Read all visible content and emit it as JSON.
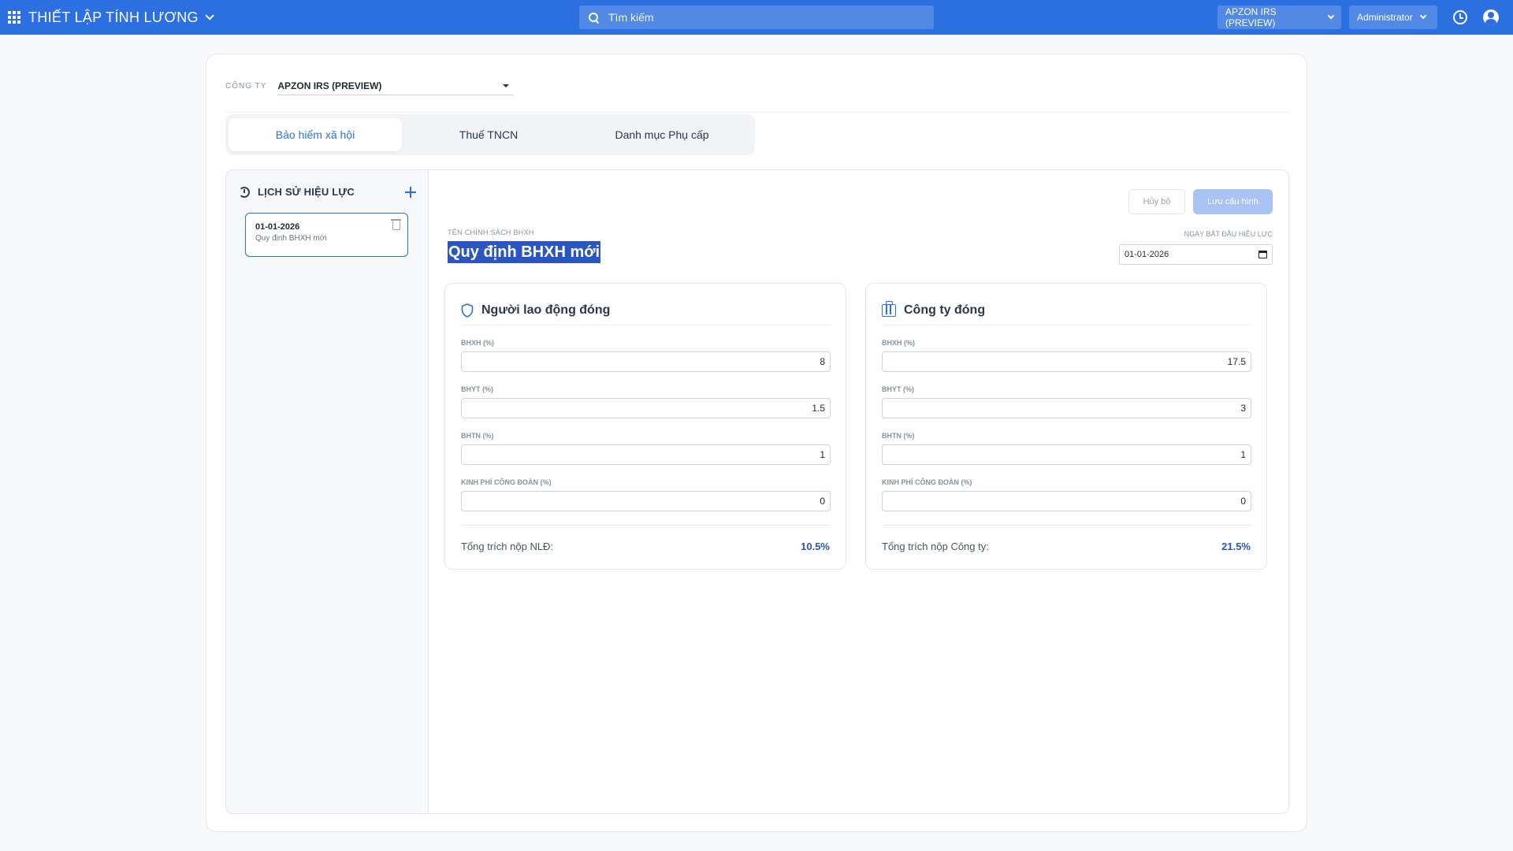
{
  "header": {
    "app_title": "THIẾT LẬP TÍNH LƯƠNG",
    "search_placeholder": "Tìm kiếm",
    "company_dropdown": "APZON IRS (PREVIEW)",
    "user_dropdown": "Administrator",
    "icons": [
      "apps-grid-icon",
      "search-icon",
      "clock-icon",
      "user-icon"
    ]
  },
  "company": {
    "label": "CÔNG TY",
    "selected": "APZON IRS (PREVIEW)"
  },
  "tabs": [
    {
      "label": "Bảo hiểm xã hội",
      "active": true
    },
    {
      "label": "Thuế TNCN",
      "active": false
    },
    {
      "label": "Danh mục Phụ cấp",
      "active": false
    }
  ],
  "history": {
    "title": "LỊCH SỬ HIỆU LỰC",
    "items": [
      {
        "date": "01-01-2026",
        "name": "Quy định BHXH mới"
      }
    ]
  },
  "form": {
    "cancel_label": "Hủy bỏ",
    "save_label": "Lưu cấu hình",
    "policy_label": "TÊN CHÍNH SÁCH BHXH",
    "policy_name": "Quy định BHXH mới",
    "date_label": "NGÀY BẮT ĐẦU HIỆU LỰC",
    "date_value": "01-01-2026"
  },
  "employee": {
    "title": "Người lao động đóng",
    "fields": [
      {
        "label": "BHXH (%)",
        "value": "8"
      },
      {
        "label": "BHYT (%)",
        "value": "1.5"
      },
      {
        "label": "BHTN (%)",
        "value": "1"
      },
      {
        "label": "KINH PHÍ CÔNG ĐOÀN (%)",
        "value": "0"
      }
    ],
    "total_label": "Tổng trích nộp NLĐ:",
    "total_value": "10.5%"
  },
  "company_pay": {
    "title": "Công ty đóng",
    "fields": [
      {
        "label": "BHXH (%)",
        "value": "17.5"
      },
      {
        "label": "BHYT (%)",
        "value": "3"
      },
      {
        "label": "BHTN (%)",
        "value": "1"
      },
      {
        "label": "KINH PHÍ CÔNG ĐOÀN (%)",
        "value": "0"
      }
    ],
    "total_label": "Tổng trích nộp Công ty:",
    "total_value": "21.5%"
  },
  "colors": {
    "primary": "#2b6fe0",
    "total_value": "#2b55c0",
    "save_disabled": "#a9c3f2"
  }
}
